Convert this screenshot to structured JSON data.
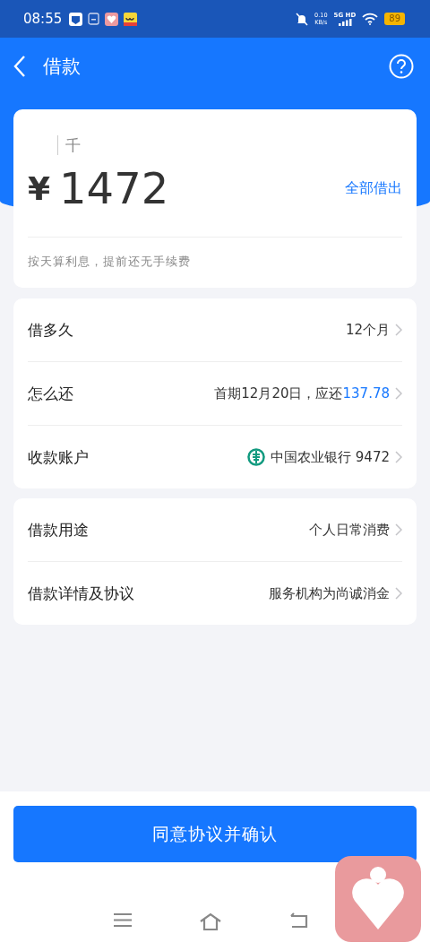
{
  "status_bar": {
    "time": "08:55",
    "net_speed": "0.10",
    "net_unit": "KB/s",
    "network": "5G HD",
    "battery": "89"
  },
  "header": {
    "title": "借款"
  },
  "amount_card": {
    "unit_hint": "千",
    "currency": "¥",
    "amount": "1472",
    "borrow_all": "全部借出",
    "note": "按天算利息，提前还无手续费"
  },
  "groups": [
    {
      "rows": [
        {
          "kind": "text",
          "label": "借多久",
          "value": "12个月"
        },
        {
          "kind": "text",
          "label": "怎么还",
          "value": "首期12月20日，应还",
          "highlight": "137.78"
        },
        {
          "kind": "bank",
          "label": "收款账户",
          "value": "中国农业银行 9472"
        }
      ]
    },
    {
      "rows": [
        {
          "kind": "text",
          "label": "借款用途",
          "value": "个人日常消费"
        },
        {
          "kind": "text",
          "label": "借款详情及协议",
          "value": "服务机构为尚诚消金"
        }
      ]
    }
  ],
  "confirm_button": "同意协议并确认"
}
